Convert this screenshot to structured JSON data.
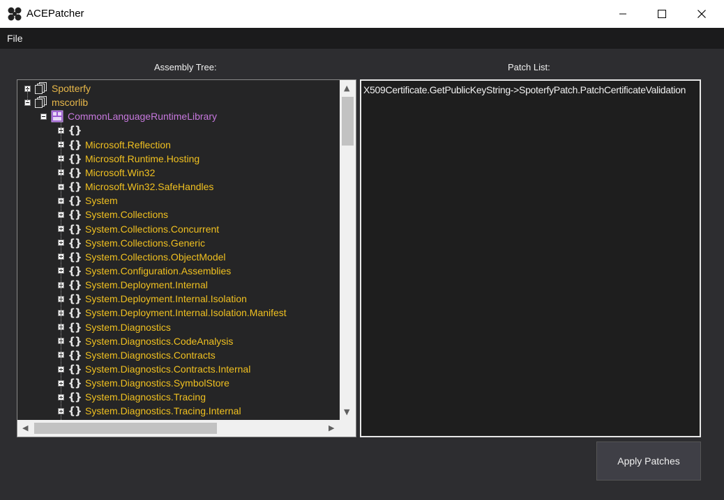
{
  "window": {
    "title": "ACEPatcher",
    "minimize_icon": "minimize-icon",
    "maximize_icon": "maximize-icon",
    "close_icon": "close-icon"
  },
  "menu": {
    "file": "File"
  },
  "assembly_tree": {
    "label": "Assembly Tree:",
    "assemblies": [
      {
        "name": "Spotterfy",
        "expanded": false,
        "color": "#e8b84a"
      },
      {
        "name": "mscorlib",
        "expanded": true,
        "color": "#e8b84a"
      }
    ],
    "module": {
      "name": "CommonLanguageRuntimeLibrary",
      "expanded": true,
      "color": "#c678dd"
    },
    "namespaces": [
      "",
      "Microsoft.Reflection",
      "Microsoft.Runtime.Hosting",
      "Microsoft.Win32",
      "Microsoft.Win32.SafeHandles",
      "System",
      "System.Collections",
      "System.Collections.Concurrent",
      "System.Collections.Generic",
      "System.Collections.ObjectModel",
      "System.Configuration.Assemblies",
      "System.Deployment.Internal",
      "System.Deployment.Internal.Isolation",
      "System.Deployment.Internal.Isolation.Manifest",
      "System.Diagnostics",
      "System.Diagnostics.CodeAnalysis",
      "System.Diagnostics.Contracts",
      "System.Diagnostics.Contracts.Internal",
      "System.Diagnostics.SymbolStore",
      "System.Diagnostics.Tracing",
      "System.Diagnostics.Tracing.Internal"
    ],
    "namespace_color": "#f0c020"
  },
  "patch_list": {
    "label": "Patch List:",
    "items": [
      "X509Certificate.GetPublicKeyString->SpoterfyPatch.PatchCertificateValidation"
    ]
  },
  "apply_button": "Apply Patches"
}
